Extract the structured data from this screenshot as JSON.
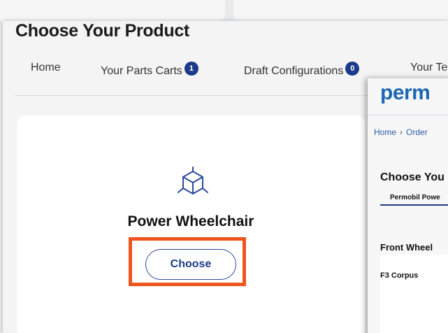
{
  "main": {
    "title": "Choose Your Product",
    "nav": {
      "home": "Home",
      "parts_carts": "Your Parts Carts",
      "parts_carts_count": "1",
      "draft_configs": "Draft Configurations",
      "draft_configs_count": "0",
      "your_te": "Your Te"
    },
    "card": {
      "icon": "cube-icon",
      "title": "Power Wheelchair",
      "choose_label": "Choose"
    }
  },
  "side_window": {
    "logo": "perm",
    "breadcrumb": [
      "Home",
      "Order"
    ],
    "heading": "Choose You",
    "tab": "Permobil Powe",
    "section": "Front Wheel",
    "card_label": "F3 Corpus"
  },
  "colors": {
    "accent": "#1d3a8a",
    "highlight": "#f0541e",
    "logo": "#1d67b3"
  }
}
